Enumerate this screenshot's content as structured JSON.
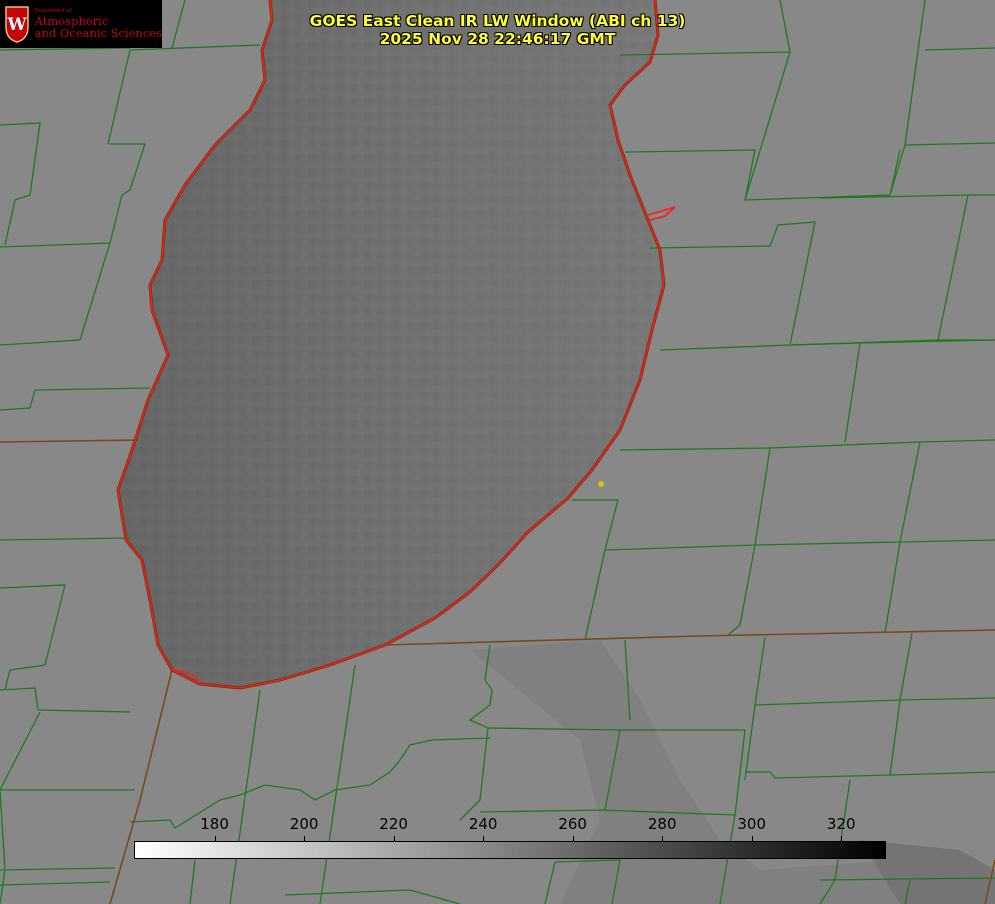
{
  "title": {
    "line1": "GOES East Clean IR LW Window (ABI ch 13)",
    "line2": "2025 Nov 28 22:46:17 GMT"
  },
  "logo": {
    "department": "Department of",
    "line1": "Atmospheric",
    "line2": "and Oceanic Sciences",
    "crest_letter": "W",
    "color": "#c5050c"
  },
  "colorbar": {
    "ticks": [
      "180",
      "200",
      "220",
      "240",
      "260",
      "280",
      "300",
      "320"
    ],
    "tick_values": [
      180,
      200,
      220,
      240,
      260,
      280,
      300,
      320
    ],
    "min": 162,
    "max": 330,
    "gradient": "white-to-black"
  },
  "colors": {
    "background": "#8a8a8a",
    "lake": "#6f6f6f",
    "coastline": "#ff1a1a",
    "county_lines": "#1f7a1f",
    "state_lines": "#7a4a1a",
    "title_text": "#ffff33",
    "marker": "#d8c300"
  },
  "marker": {
    "icon": "yellow-dot-icon"
  }
}
